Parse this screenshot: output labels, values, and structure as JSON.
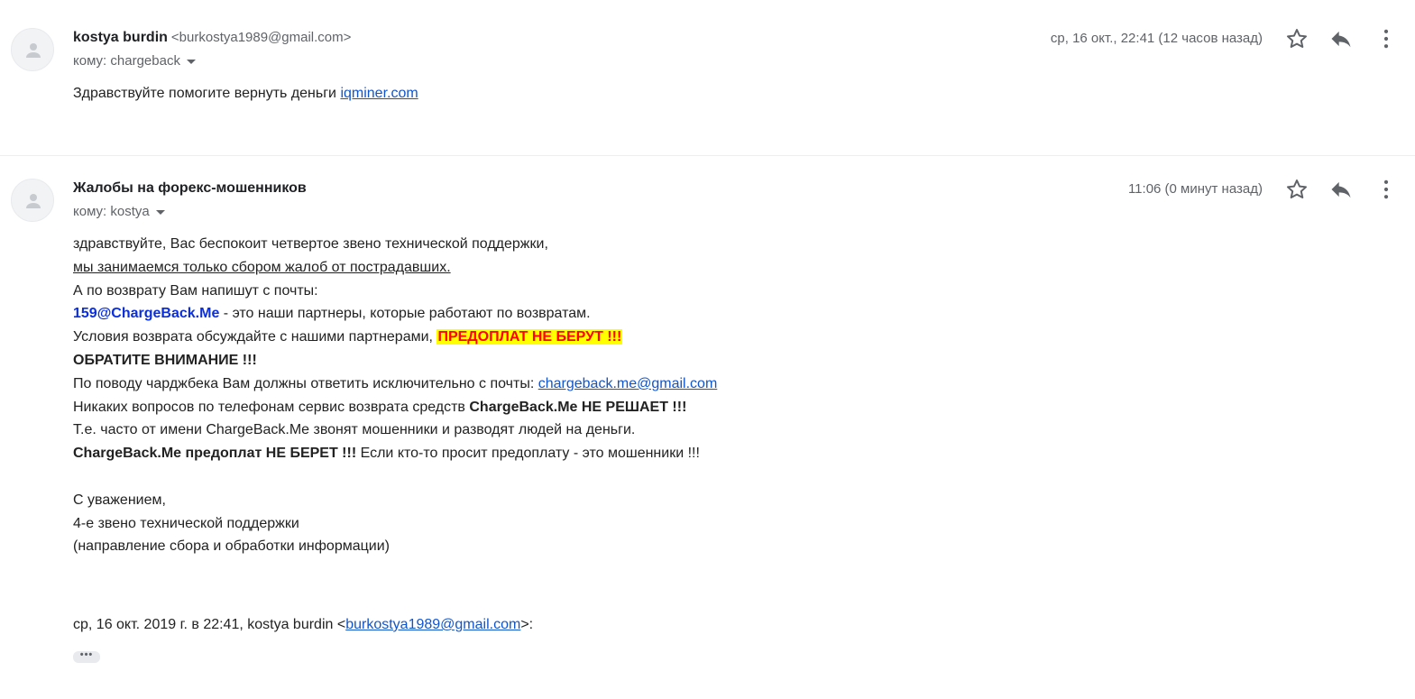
{
  "messages": [
    {
      "sender_name": "kostya burdin",
      "sender_email": "<burkostya1989@gmail.com>",
      "recipient": "кому: chargeback",
      "timestamp": "ср, 16 окт., 22:41 (12 часов назад)",
      "body_text": "Здравствуйте помогите вернуть деньги ",
      "body_link": "iqminer.com"
    },
    {
      "sender_name": "Жалобы на форекс-мошенников",
      "recipient": "кому: kostya",
      "timestamp": "11:06 (0 минут назад)",
      "lines": {
        "l1": "здравствуйте, Вас беспокоит четвертое звено технической поддержки,",
        "l2": "мы занимаемся только сбором жалоб от пострадавших.",
        "l3": "А по возврату Вам напишут с почты:",
        "l4_email": "159@ChargeBack.Me",
        "l4_rest": " - это наши партнеры, которые работают по возвратам.",
        "l5_text": "Условия возврата обсуждайте с нашими партнерами, ",
        "l5_highlight": "ПРЕДОПЛАТ НЕ БЕРУТ !!!",
        "l6": "ОБРАТИТЕ ВНИМАНИЕ !!!",
        "l7_text": "По поводу чарджбека Вам должны ответить исключительно с почты: ",
        "l7_link": "chargeback.me@gmail.com",
        "l8_text": "Никаких вопросов по телефонам сервис возврата средств ",
        "l8_bold": "ChargeBack.Me НЕ РЕШАЕТ !!!",
        "l9": "Т.е. часто от имени ChargeBack.Me звонят мошенники и разводят людей на деньги.",
        "l10_bold": "ChargeBack.Me предоплат НЕ БЕРЕТ !!!",
        "l10_rest": " Если кто-то просит предоплату - это мошенники !!!",
        "l11": "С уважением,",
        "l12": "4-е звено технической поддержки",
        "l13": "(направление сбора и обработки информации)"
      },
      "quote_prefix": "ср, 16 окт. 2019 г. в 22:41, kostya burdin <",
      "quote_link": "burkostya1989@gmail.com",
      "quote_suffix": ">:",
      "ellipsis": "•••"
    }
  ],
  "icons": [
    "person-icon",
    "star-icon",
    "reply-icon",
    "more-vert-icon",
    "chevron-down-icon"
  ]
}
